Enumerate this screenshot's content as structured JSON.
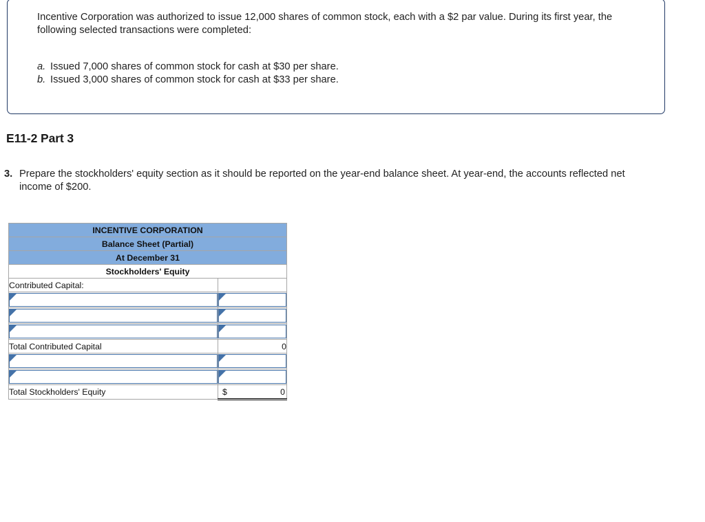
{
  "problem": {
    "intro": "Incentive Corporation was authorized to issue 12,000 shares of common stock, each with a $2 par value. During its first year, the following selected transactions were completed:",
    "transactions": [
      {
        "marker": "a.",
        "text": "Issued 7,000 shares of common stock for cash at $30 per share."
      },
      {
        "marker": "b.",
        "text": "Issued 3,000 shares of common stock for cash at $33 per share."
      }
    ]
  },
  "part": {
    "heading": "E11-2 Part 3",
    "requirement_number": "3.",
    "requirement_text": "Prepare the stockholders' equity section as it should be reported on the year-end balance sheet. At year-end, the accounts reflected net income of $200."
  },
  "balance_sheet": {
    "title_lines": [
      "INCENTIVE CORPORATION",
      "Balance Sheet (Partial)",
      "At December 31"
    ],
    "section_heading": "Stockholders' Equity",
    "contributed_capital_label": "Contributed Capital:",
    "total_contributed_capital_label": "Total Contributed Capital",
    "total_contributed_capital_value": "0",
    "total_stockholders_equity_label": "Total Stockholders' Equity",
    "total_stockholders_equity_currency": "$",
    "total_stockholders_equity_value": "0",
    "blank_rows_upper": 3,
    "blank_rows_lower": 2
  },
  "colors": {
    "header_blue": "#82ACDD",
    "input_border_blue": "#4472A8",
    "box_border_navy": "#1F3864",
    "grid_gray": "#a6a6a6"
  }
}
